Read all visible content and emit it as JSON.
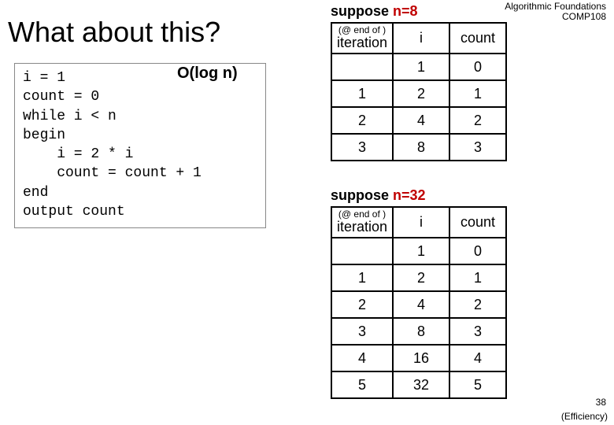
{
  "title": "What about this?",
  "course": {
    "line1": "Algorithmic Foundations",
    "line2": "COMP108"
  },
  "complexity": "O(log n)",
  "code": "i = 1\ncount = 0\nwhile i < n\nbegin\n    i = 2 * i\n    count = count + 1\nend\noutput count",
  "suppose1": {
    "prefix": "suppose ",
    "nlabel": "n=8"
  },
  "suppose2": {
    "prefix": "suppose ",
    "nlabel": "n=32"
  },
  "headers": {
    "endof": "(@ end of )",
    "iter": "iteration",
    "i": "i",
    "count": "count"
  },
  "table1": [
    {
      "iter": "",
      "i": "1",
      "count": "0"
    },
    {
      "iter": "1",
      "i": "2",
      "count": "1"
    },
    {
      "iter": "2",
      "i": "4",
      "count": "2"
    },
    {
      "iter": "3",
      "i": "8",
      "count": "3"
    }
  ],
  "table2": [
    {
      "iter": "",
      "i": "1",
      "count": "0"
    },
    {
      "iter": "1",
      "i": "2",
      "count": "1"
    },
    {
      "iter": "2",
      "i": "4",
      "count": "2"
    },
    {
      "iter": "3",
      "i": "8",
      "count": "3"
    },
    {
      "iter": "4",
      "i": "16",
      "count": "4"
    },
    {
      "iter": "5",
      "i": "32",
      "count": "5"
    }
  ],
  "slidenum": "38",
  "footer": "(Efficiency)"
}
